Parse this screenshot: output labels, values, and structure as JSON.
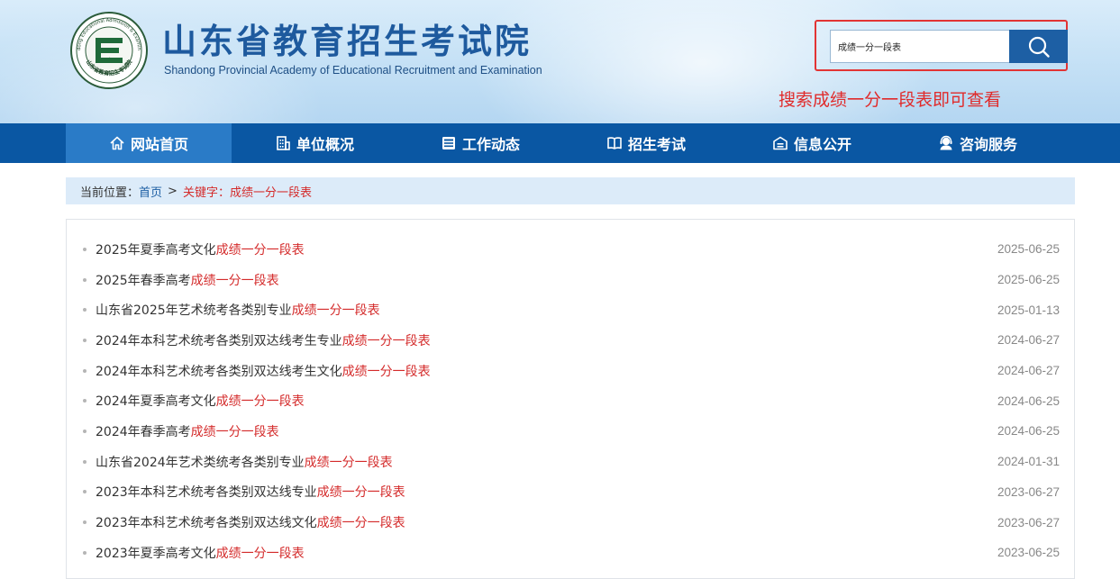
{
  "header": {
    "title": "山东省教育招生考试院",
    "subtitle": "Shandong Provincial Academy of Educational Recruitment and Examination",
    "logo_letter": "E",
    "logo_ring_text_top": "Shandong Educational Admission & Examination",
    "logo_ring_text_bottom": "山东省教育招生考试院"
  },
  "search": {
    "value": "成绩一分一段表",
    "button_icon": "search-icon",
    "hint": "搜索成绩一分一段表即可查看",
    "highlight_color": "#e23434"
  },
  "nav": {
    "items": [
      {
        "label": "网站首页",
        "icon": "home-icon",
        "active": true
      },
      {
        "label": "单位概况",
        "icon": "building-icon",
        "active": false
      },
      {
        "label": "工作动态",
        "icon": "news-icon",
        "active": false
      },
      {
        "label": "招生考试",
        "icon": "book-icon",
        "active": false
      },
      {
        "label": "信息公开",
        "icon": "info-icon",
        "active": false
      },
      {
        "label": "咨询服务",
        "icon": "support-icon",
        "active": false
      }
    ]
  },
  "breadcrumb": {
    "prefix": "当前位置：",
    "home": "首页",
    "separator": ">",
    "keyword_label": "关键字：成绩一分一段表"
  },
  "results": [
    {
      "title": "2025年夏季高考文化",
      "highlight": "成绩一分一段表",
      "date": "2025-06-25"
    },
    {
      "title": "2025年春季高考",
      "highlight": "成绩一分一段表",
      "date": "2025-06-25"
    },
    {
      "title": "山东省2025年艺术统考各类别专业",
      "highlight": "成绩一分一段表",
      "date": "2025-01-13"
    },
    {
      "title": "2024年本科艺术统考各类别双达线考生专业",
      "highlight": "成绩一分一段表",
      "date": "2024-06-27"
    },
    {
      "title": "2024年本科艺术统考各类别双达线考生文化",
      "highlight": "成绩一分一段表",
      "date": "2024-06-27"
    },
    {
      "title": "2024年夏季高考文化",
      "highlight": "成绩一分一段表",
      "date": "2024-06-25"
    },
    {
      "title": "2024年春季高考",
      "highlight": "成绩一分一段表",
      "date": "2024-06-25"
    },
    {
      "title": "山东省2024年艺术类统考各类别专业",
      "highlight": "成绩一分一段表",
      "date": "2024-01-31"
    },
    {
      "title": "2023年本科艺术统考各类别双达线专业",
      "highlight": "成绩一分一段表",
      "date": "2023-06-27"
    },
    {
      "title": "2023年本科艺术统考各类别双达线文化",
      "highlight": "成绩一分一段表",
      "date": "2023-06-27"
    },
    {
      "title": "2023年夏季高考文化",
      "highlight": "成绩一分一段表",
      "date": "2023-06-25"
    }
  ],
  "colors": {
    "brand_blue": "#0a57a3",
    "nav_active": "#2a7bc7",
    "keyword_red": "#d42b2b",
    "breadcrumb_bg": "#dcebf9"
  }
}
